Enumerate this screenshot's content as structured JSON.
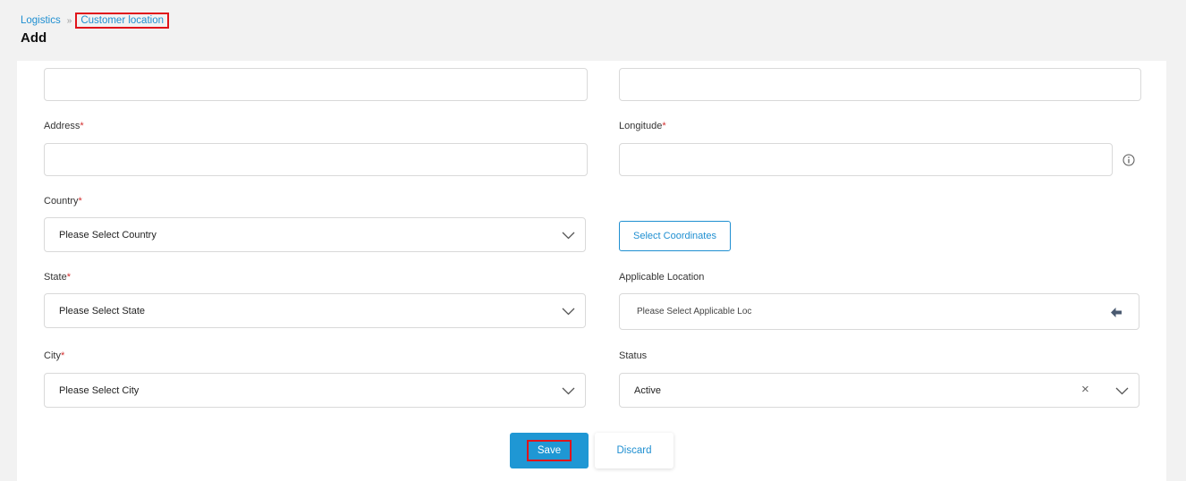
{
  "breadcrumb": {
    "parent": "Logistics",
    "separator": "»",
    "current": "Customer location"
  },
  "page_title": "Add",
  "form": {
    "address": {
      "label": "Address",
      "required_mark": "*",
      "value": ""
    },
    "longitude": {
      "label": "Longitude",
      "required_mark": "*",
      "value": ""
    },
    "country": {
      "label": "Country",
      "required_mark": "*",
      "value": "Please Select Country"
    },
    "state": {
      "label": "State",
      "required_mark": "*",
      "value": "Please Select State"
    },
    "city": {
      "label": "City",
      "required_mark": "*",
      "value": "Please Select City"
    },
    "select_coordinates_label": "Select Coordinates",
    "applicable_location": {
      "label": "Applicable Location",
      "placeholder": "Please Select Applicable Loc"
    },
    "status": {
      "label": "Status",
      "value": "Active",
      "clear_symbol": "×"
    }
  },
  "actions": {
    "save_label": "Save",
    "discard_label": "Discard"
  },
  "colors": {
    "accent": "#1f8fd1",
    "save_bg": "#1f97d4",
    "highlight": "#e0141b",
    "required": "#d32f2f"
  },
  "icons": [
    "chevron-double-right-icon",
    "info-icon",
    "chevron-down-icon",
    "arrow-left-icon",
    "close-icon"
  ]
}
